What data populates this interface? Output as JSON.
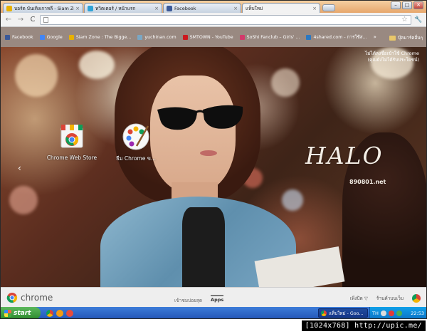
{
  "tabs": [
    {
      "label": "บอร์ด บันเทิงเกาหลี - Siam Zone",
      "color": "#e8b100"
    },
    {
      "label": "ทวิตเตอร์ / หน้าแรก",
      "color": "#2fa3d6"
    },
    {
      "label": "Facebook",
      "color": "#3b5998"
    },
    {
      "label": "แท็บใหม่",
      "color": "#ffffff"
    }
  ],
  "window": {
    "minimize": "–",
    "maximize": "□",
    "close": "✕"
  },
  "toolbar": {
    "back": "←",
    "forward": "→",
    "reload": "C",
    "address_value": "",
    "star": "☆",
    "wrench": "🔧"
  },
  "bookmarks": [
    {
      "label": "Facebook",
      "color": "#3b5998"
    },
    {
      "label": "Google",
      "color": "#4285f4"
    },
    {
      "label": "Siam Zone : The Bigge...",
      "color": "#e8b100"
    },
    {
      "label": "yuchinan.com",
      "color": "#7aa7c4"
    },
    {
      "label": "SMTOWN - YouTube",
      "color": "#cc181e"
    },
    {
      "label": "SoShi Fanclub – Girls' ...",
      "color": "#d23a6b"
    },
    {
      "label": "4shared.com - การใช้ส...",
      "color": "#2b78c2"
    }
  ],
  "bookmarks_more": "»",
  "bookmarks_other": "บุ๊คมาร์คอื่นๆ",
  "signin": {
    "line1": "ไม่ได้ลงชื่อเข้าใช้ Chrome",
    "line2": "(คุณยังไม่ได้รับประโยชน์)"
  },
  "apps": [
    {
      "label": "Chrome Web Store",
      "icon": "webstore-icon"
    },
    {
      "label": "ธีม Chrome ข...",
      "icon": "paint-icon"
    }
  ],
  "pager_prev": "‹",
  "wallpaper": {
    "title": "HALO",
    "subtitle": "890801.net"
  },
  "ntp_footer": {
    "logo": "chrome",
    "pages": [
      {
        "label": "เข้าชมบ่อยสุด",
        "selected": false
      },
      {
        "label": "Apps",
        "selected": true
      }
    ],
    "recently_closed": "เพิ่งปิด ▽",
    "web_store": "ร้านค้าบนเว็บ"
  },
  "taskbar": {
    "start": "start",
    "task_label": "แท็บใหม่ - Goo...",
    "lang": "TH",
    "clock": "22:53"
  },
  "watermark": "[1024x768] http://upic.me/"
}
